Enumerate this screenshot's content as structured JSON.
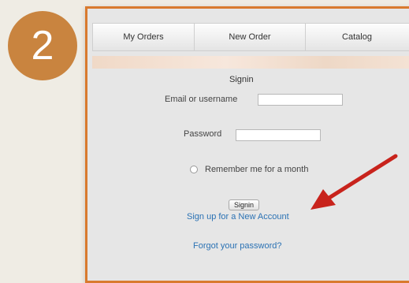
{
  "step": {
    "number": "2"
  },
  "nav": {
    "items": [
      {
        "label": "My Orders"
      },
      {
        "label": "New Order"
      },
      {
        "label": "Catalog"
      }
    ]
  },
  "signin": {
    "title": "Signin",
    "email_label": "Email or username",
    "email_value": "",
    "password_label": "Password",
    "password_value": "",
    "remember_label": "Remember me for a month",
    "remember_checked": false,
    "button_label": "Signin",
    "signup_link": "Sign up for a New Account",
    "forgot_link": "Forgot your password?"
  },
  "colors": {
    "badge": "#c9843f",
    "frame_border": "#d97a2e",
    "link": "#2b72b4",
    "arrow": "#c8231c"
  },
  "icons": {
    "arrow": "red-arrow-icon",
    "radio": "radio-button-icon"
  }
}
